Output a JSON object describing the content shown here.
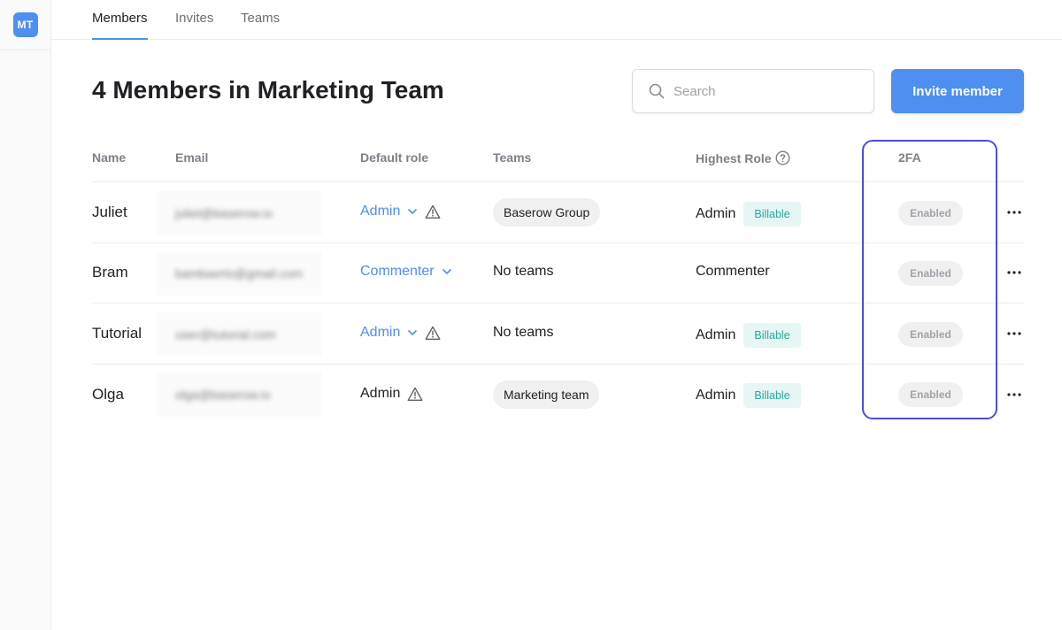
{
  "sidebar": {
    "avatar": "MT"
  },
  "tabs": [
    {
      "label": "Members",
      "active": true
    },
    {
      "label": "Invites",
      "active": false
    },
    {
      "label": "Teams",
      "active": false
    }
  ],
  "title": "4 Members in Marketing Team",
  "search": {
    "placeholder": "Search",
    "icon": "search-icon"
  },
  "invite_button": "Invite member",
  "columns": {
    "name": "Name",
    "email": "Email",
    "default_role": "Default role",
    "teams": "Teams",
    "highest_role": "Highest Role",
    "twofa": "2FA"
  },
  "members": [
    {
      "name": "Juliet",
      "email": "juliet@baserow.io",
      "default_role": "Admin",
      "team": "Baserow Group",
      "highest_role": "Admin",
      "billable": "Billable",
      "twofa": "Enabled"
    },
    {
      "name": "Bram",
      "email": "bambaerts@gmail.com",
      "default_role": "Commenter",
      "team": "No teams",
      "highest_role": "Commenter",
      "billable": "",
      "twofa": "Enabled"
    },
    {
      "name": "Tutorial",
      "email": "user@tutorial.com",
      "default_role": "Admin",
      "team": "No teams",
      "highest_role": "Admin",
      "billable": "Billable",
      "twofa": "Enabled"
    },
    {
      "name": "Olga",
      "email": "olga@baserow.io",
      "default_role": "Admin",
      "team": "Marketing team",
      "highest_role": "Admin",
      "billable": "Billable",
      "twofa": "Enabled"
    }
  ],
  "colors": {
    "accent": "#4e8ff0",
    "billable_text": "#2aa79b",
    "highlight": "#4b4fd6"
  }
}
